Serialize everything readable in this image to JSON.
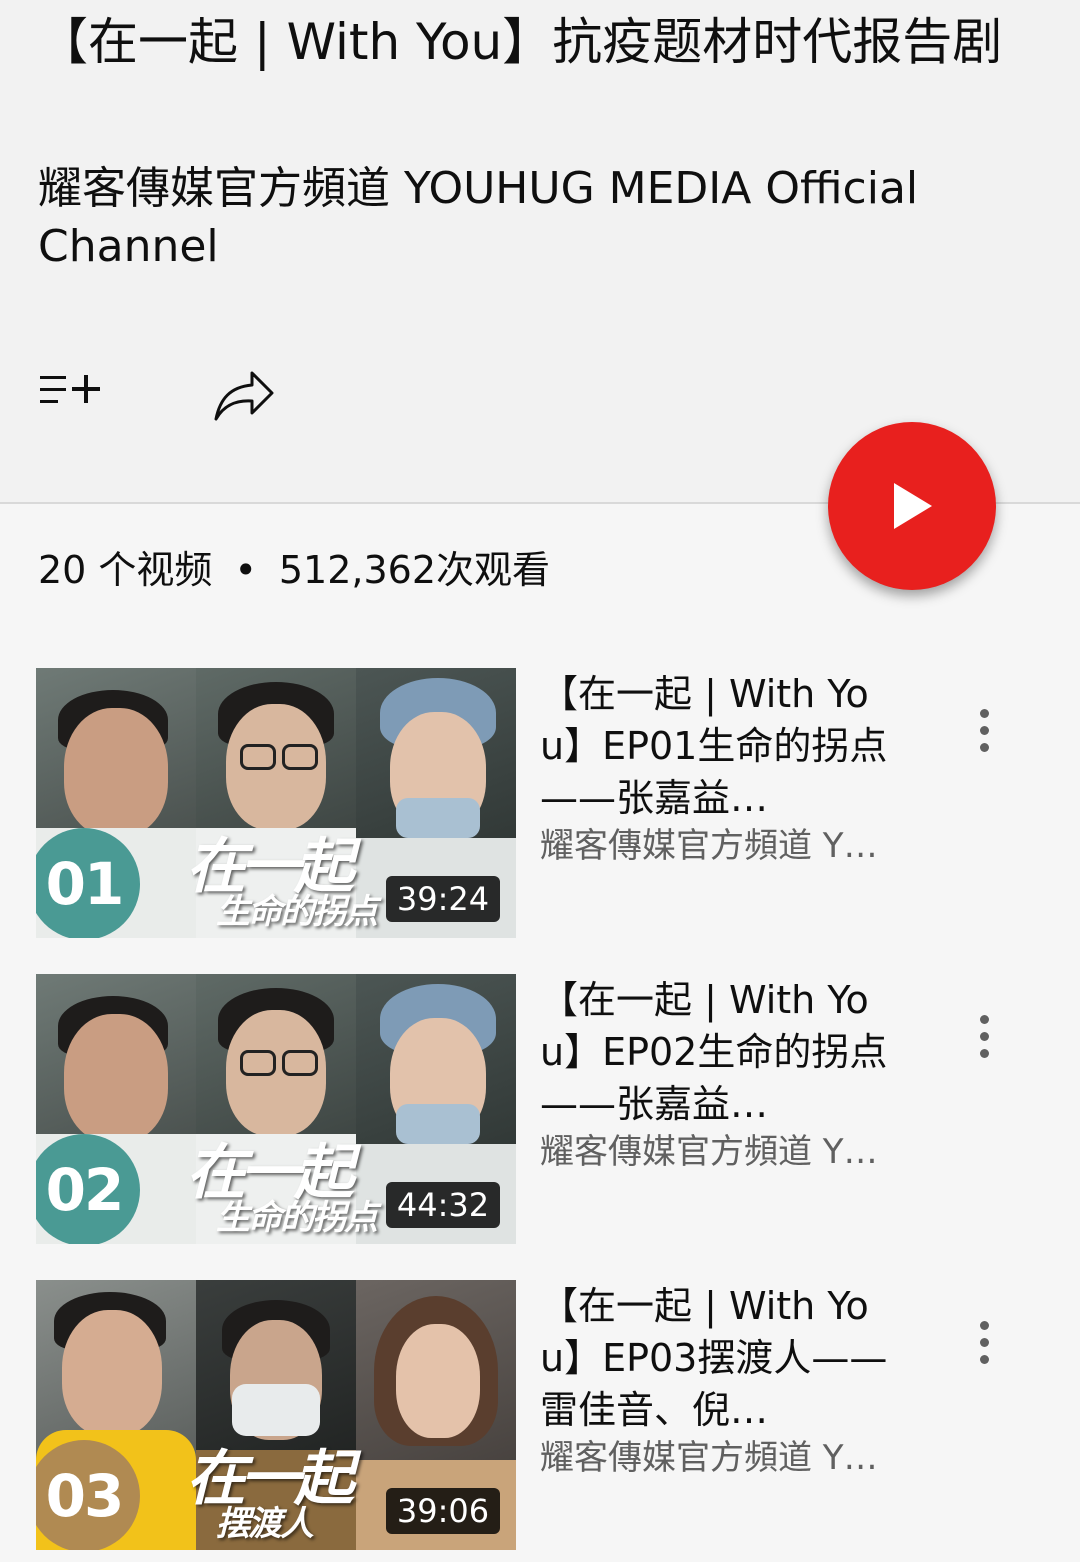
{
  "playlist": {
    "title": "【在一起 | With You】抗疫题材时代报告剧",
    "channel": "耀客傳媒官方頻道 YOUHUG MEDIA Official Channel",
    "video_count": "20 个视频",
    "separator": "•",
    "views": "512,362次观看",
    "accent_color": "#e8201e"
  },
  "actions": {
    "add_icon": "playlist-add-icon",
    "share_icon": "share-icon",
    "play_icon": "play-icon"
  },
  "videos": [
    {
      "title": "【在一起 | With You】EP01生命的拐点——张嘉益…",
      "channel": "耀客傳媒官方頻道 Y…",
      "duration": "39:24",
      "episode": "01",
      "badge_color": "#4a9a94",
      "thumb_title": "在一起",
      "thumb_subtitle": "生命的拐点"
    },
    {
      "title": "【在一起 | With You】EP02生命的拐点——张嘉益…",
      "channel": "耀客傳媒官方頻道 Y…",
      "duration": "44:32",
      "episode": "02",
      "badge_color": "#4a9a94",
      "thumb_title": "在一起",
      "thumb_subtitle": "生命的拐点"
    },
    {
      "title": "【在一起 | With You】EP03摆渡人——雷佳音、倪…",
      "channel": "耀客傳媒官方頻道 Y…",
      "duration": "39:06",
      "episode": "03",
      "badge_color": "#b08a52",
      "thumb_title": "在一起",
      "thumb_subtitle": "摆渡人"
    }
  ]
}
